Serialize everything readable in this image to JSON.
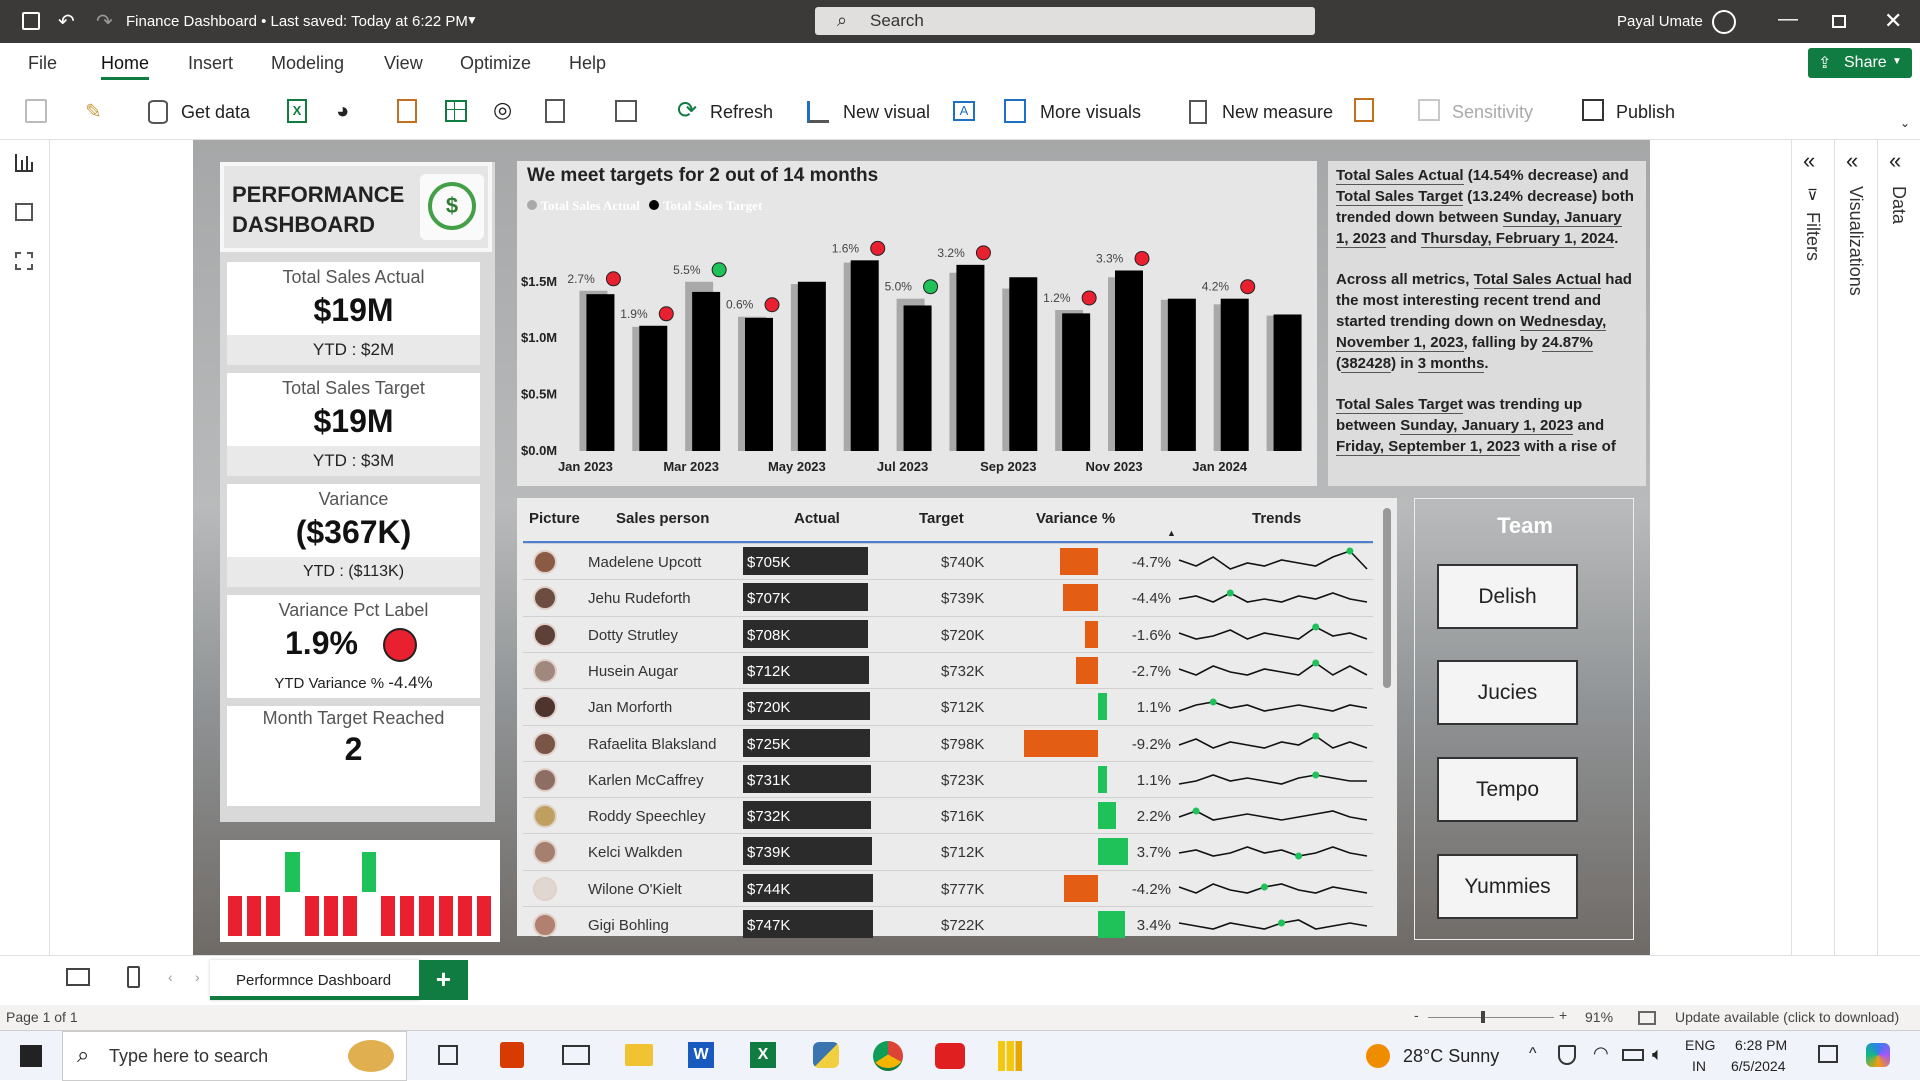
{
  "window": {
    "title": "Finance Dashboard • Last saved: Today at 6:22 PM",
    "search_placeholder": "Search",
    "user": "Payal Umate"
  },
  "ribbon_tabs": [
    "File",
    "Home",
    "Insert",
    "Modeling",
    "View",
    "Optimize",
    "Help"
  ],
  "share_label": "Share",
  "ribbon_buttons": {
    "get_data": "Get data",
    "refresh": "Refresh",
    "new_visual": "New visual",
    "more_visuals": "More visuals",
    "new_measure": "New measure",
    "sensitivity": "Sensitivity",
    "publish": "Publish"
  },
  "header_card": {
    "line1": "PERFORMANCE",
    "line2": "DASHBOARD"
  },
  "kpis": [
    {
      "label": "Total Sales Actual",
      "value": "$19M",
      "foot": "YTD : $2M"
    },
    {
      "label": "Total Sales Target",
      "value": "$19M",
      "foot": "YTD : $3M"
    },
    {
      "label": "Variance",
      "value": "($367K)",
      "foot": "YTD : ($113K)"
    },
    {
      "label": "Variance Pct Label",
      "value": "1.9%",
      "foot_label": "YTD Variance %",
      "foot_value": "-4.4%"
    },
    {
      "label": "Month Target Reached",
      "value": "2"
    }
  ],
  "mini_bars": {
    "heights": [
      0.45,
      0.45,
      0.45,
      1.0,
      0.45,
      0.45,
      0.45,
      1.0,
      0.45,
      0.45,
      0.45,
      0.45,
      0.45,
      0.45
    ],
    "hit": [
      false,
      false,
      false,
      true,
      false,
      false,
      false,
      true,
      false,
      false,
      false,
      false,
      false,
      false
    ]
  },
  "chart_data": {
    "type": "bar",
    "title": "We meet targets for 2 out of 14 months",
    "legend": [
      "Total Sales Actual",
      "Total Sales Target"
    ],
    "legend_position": "top-left",
    "xticks": [
      "Jan 2023",
      "Mar 2023",
      "May 2023",
      "Jul 2023",
      "Sep 2023",
      "Nov 2023",
      "Jan 2024"
    ],
    "yticks": [
      "$0.0M",
      "$0.5M",
      "$1.0M",
      "$1.5M"
    ],
    "ylim": [
      0,
      1.95
    ],
    "months": [
      "Jan 2023",
      "Feb 2023",
      "Mar 2023",
      "Apr 2023",
      "May 2023",
      "Jun 2023",
      "Jul 2023",
      "Aug 2023",
      "Sep 2023",
      "Oct 2023",
      "Nov 2023",
      "Dec 2023",
      "Jan 2024",
      "Feb 2024"
    ],
    "series": [
      {
        "name": "Total Sales Target",
        "values": [
          1.42,
          1.1,
          1.5,
          1.19,
          1.48,
          1.67,
          1.35,
          1.58,
          1.44,
          1.25,
          1.54,
          1.34,
          1.3,
          1.2
        ]
      },
      {
        "name": "Total Sales Actual",
        "values": [
          1.39,
          1.11,
          1.41,
          1.18,
          1.5,
          1.69,
          1.29,
          1.65,
          1.54,
          1.22,
          1.6,
          1.35,
          1.35,
          1.21
        ]
      }
    ],
    "variance_labels": [
      "2.7%",
      "1.9%",
      "5.5%",
      "0.6%",
      "",
      "1.6%",
      "5.0%",
      "3.2%",
      "",
      "1.2%",
      "3.3%",
      "",
      "4.2%",
      ""
    ],
    "target_hit": [
      false,
      false,
      true,
      false,
      false,
      false,
      true,
      false,
      false,
      false,
      false,
      false,
      false,
      false
    ]
  },
  "narrative": {
    "p1": [
      {
        "t": "Total Sales Actual",
        "u": true
      },
      {
        "t": " (14.54% decrease) and ",
        "u": false
      },
      {
        "t": "Total Sales Target",
        "u": true
      },
      {
        "t": " (13.24% decrease) both trended down between ",
        "u": false
      },
      {
        "t": "Sunday, January 1, 2023",
        "u": true
      },
      {
        "t": " and ",
        "u": false
      },
      {
        "t": "Thursday, February 1, 2024",
        "u": true
      },
      {
        "t": ".",
        "u": false
      }
    ],
    "p2": [
      {
        "t": "Across all metrics, ",
        "u": false
      },
      {
        "t": "Total Sales Actual",
        "u": true
      },
      {
        "t": " had the most interesting recent trend and started trending down on ",
        "u": false
      },
      {
        "t": "Wednesday, November 1, 2023",
        "u": true
      },
      {
        "t": ", falling by ",
        "u": false
      },
      {
        "t": "24.87%",
        "u": true
      },
      {
        "t": " (",
        "u": false
      },
      {
        "t": "382428",
        "u": true
      },
      {
        "t": ") in ",
        "u": false
      },
      {
        "t": "3 months",
        "u": true
      },
      {
        "t": ".",
        "u": false
      }
    ],
    "p3": [
      {
        "t": "Total Sales Target",
        "u": true
      },
      {
        "t": " was trending up between ",
        "u": false
      },
      {
        "t": "Sunday, January 1, 2023",
        "u": true
      },
      {
        "t": " and ",
        "u": false
      },
      {
        "t": "Friday, September 1, 2023",
        "u": true
      },
      {
        "t": " with a rise of",
        "u": false
      }
    ]
  },
  "table": {
    "headers": [
      "Picture",
      "Sales person",
      "Actual",
      "Target",
      "Variance %",
      "Trends"
    ],
    "rows": [
      {
        "name": "Madelene Upcott",
        "actual": "$705K",
        "actual_num": 705,
        "target": "$740K",
        "var": "-4.7%",
        "var_num": -4.7,
        "spark": [
          5,
          3,
          6,
          2,
          4,
          3,
          5,
          4,
          3,
          6,
          8,
          2
        ],
        "dot": 10
      },
      {
        "name": "Jehu Rudeforth",
        "actual": "$707K",
        "actual_num": 707,
        "target": "$739K",
        "var": "-4.4%",
        "var_num": -4.4,
        "spark": [
          4,
          5,
          3,
          6,
          3,
          4,
          3,
          5,
          4,
          6,
          4,
          3
        ],
        "dot": 3
      },
      {
        "name": "Dotty Strutley",
        "actual": "$708K",
        "actual_num": 708,
        "target": "$720K",
        "var": "-1.6%",
        "var_num": -1.6,
        "spark": [
          5,
          3,
          4,
          6,
          3,
          5,
          4,
          3,
          7,
          4,
          5,
          3
        ],
        "dot": 8
      },
      {
        "name": "Husein Augar",
        "actual": "$712K",
        "actual_num": 712,
        "target": "$732K",
        "var": "-2.7%",
        "var_num": -2.7,
        "spark": [
          5,
          3,
          6,
          4,
          3,
          5,
          4,
          3,
          7,
          3,
          6,
          3
        ],
        "dot": 8
      },
      {
        "name": "Jan Morforth",
        "actual": "$720K",
        "actual_num": 720,
        "target": "$712K",
        "var": "1.1%",
        "var_num": 1.1,
        "spark": [
          3,
          5,
          6,
          4,
          5,
          3,
          4,
          5,
          4,
          3,
          5,
          4
        ],
        "dot": 2
      },
      {
        "name": "Rafaelita Blaksland",
        "actual": "$725K",
        "actual_num": 725,
        "target": "$798K",
        "var": "-9.2%",
        "var_num": -9.2,
        "spark": [
          4,
          6,
          3,
          5,
          4,
          3,
          5,
          4,
          7,
          3,
          5,
          3
        ],
        "dot": 8
      },
      {
        "name": "Karlen McCaffrey",
        "actual": "$731K",
        "actual_num": 731,
        "target": "$723K",
        "var": "1.1%",
        "var_num": 1.1,
        "spark": [
          3,
          4,
          6,
          4,
          5,
          4,
          3,
          5,
          6,
          5,
          4,
          4
        ],
        "dot": 8
      },
      {
        "name": "Roddy Speechley",
        "actual": "$732K",
        "actual_num": 732,
        "target": "$716K",
        "var": "2.2%",
        "var_num": 2.2,
        "spark": [
          4,
          6,
          3,
          4,
          5,
          4,
          3,
          4,
          5,
          6,
          4,
          3
        ],
        "dot": 1
      },
      {
        "name": "Kelci Walkden",
        "actual": "$739K",
        "actual_num": 739,
        "target": "$712K",
        "var": "3.7%",
        "var_num": 3.7,
        "spark": [
          4,
          5,
          3,
          4,
          6,
          4,
          5,
          3,
          4,
          6,
          4,
          3
        ],
        "dot": 7
      },
      {
        "name": "Wilone O'Kielt",
        "actual": "$744K",
        "actual_num": 744,
        "target": "$777K",
        "var": "-4.2%",
        "var_num": -4.2,
        "spark": [
          5,
          3,
          6,
          4,
          3,
          5,
          6,
          4,
          3,
          5,
          4,
          3
        ],
        "dot": 5
      },
      {
        "name": "Gigi Bohling",
        "actual": "$747K",
        "actual_num": 747,
        "target": "$722K",
        "var": "3.4%",
        "var_num": 3.4,
        "spark": [
          5,
          4,
          3,
          5,
          4,
          3,
          5,
          6,
          3,
          4,
          5,
          4
        ],
        "dot": 6
      }
    ]
  },
  "team": {
    "title": "Team",
    "buttons": [
      "Delish",
      "Jucies",
      "Tempo",
      "Yummies"
    ]
  },
  "right_panes": [
    "Filters",
    "Visualizations",
    "Data"
  ],
  "page_tab": "Performnce Dashboard",
  "status": {
    "page": "Page 1 of 1",
    "zoom": "91%",
    "update": "Update available (click to download)"
  },
  "taskbar": {
    "search_placeholder": "Type here to search",
    "weather": "28°C  Sunny",
    "lang1": "ENG",
    "lang2": "IN",
    "time": "6:28 PM",
    "date": "6/5/2024"
  },
  "colors": {
    "red": "#e8202f",
    "green": "#1ec258",
    "orange": "#e35d14",
    "bar_actual": "#000000",
    "bar_target": "#a9a9a9"
  }
}
